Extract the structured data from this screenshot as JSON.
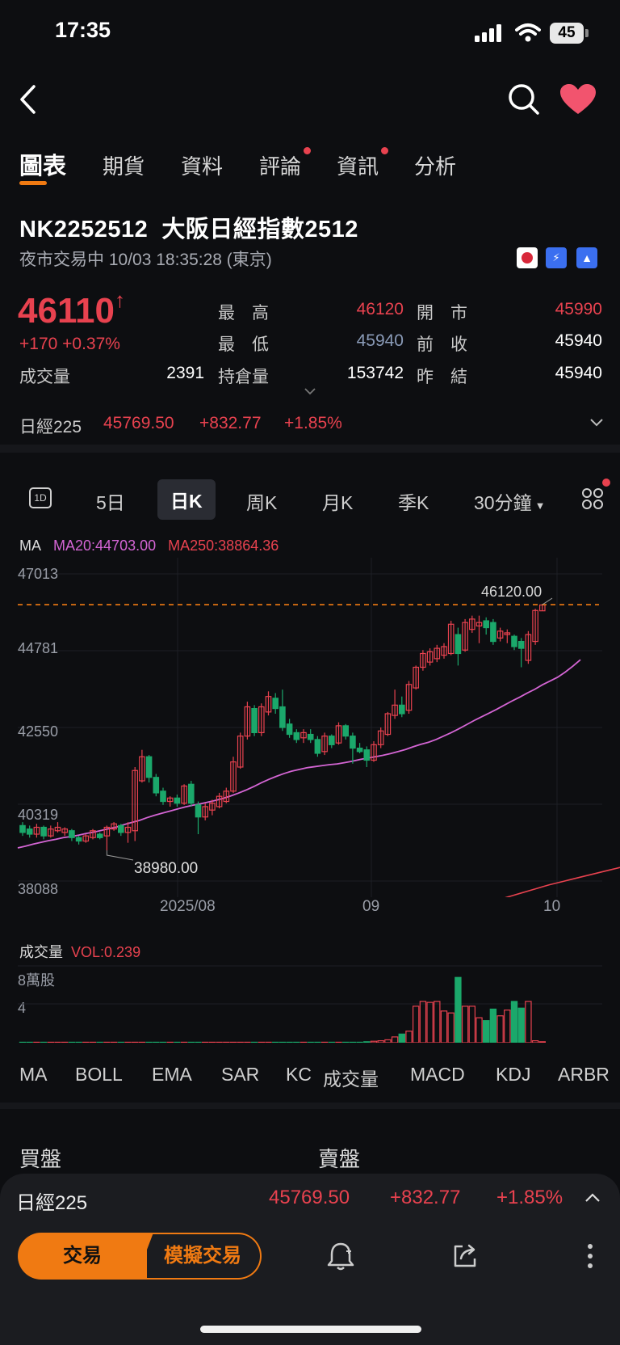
{
  "status_bar": {
    "time": "17:35",
    "battery": "45"
  },
  "tabs": [
    {
      "label": "圖表",
      "active": true,
      "dot": false
    },
    {
      "label": "期貨",
      "active": false,
      "dot": false
    },
    {
      "label": "資料",
      "active": false,
      "dot": false
    },
    {
      "label": "評論",
      "active": false,
      "dot": true
    },
    {
      "label": "資訊",
      "active": false,
      "dot": true
    },
    {
      "label": "分析",
      "active": false,
      "dot": false
    }
  ],
  "header": {
    "code": "NK2252512",
    "name": "大阪日經指數2512",
    "session": "夜市交易中 10/03 18:35:28 (東京)"
  },
  "quote": {
    "price": "46110",
    "change": "+170",
    "change_pct": "+0.37%",
    "volume_label": "成交量",
    "volume_value": "2391",
    "stats": [
      {
        "label": "最　高",
        "value": "46120",
        "color": "red"
      },
      {
        "label": "開　市",
        "value": "45990",
        "color": "red"
      },
      {
        "label": "最　低",
        "value": "45940",
        "color": "blue"
      },
      {
        "label": "前　收",
        "value": "45940",
        "color": "white"
      },
      {
        "label": "持倉量",
        "value": "153742",
        "color": "white"
      },
      {
        "label": "昨　結",
        "value": "45940",
        "color": "white"
      }
    ]
  },
  "index_bar": {
    "name": "日經225",
    "value": "45769.50",
    "change": "+832.77",
    "pct": "+1.85%"
  },
  "periods": [
    {
      "label": "5日",
      "active": false
    },
    {
      "label": "日K",
      "active": true
    },
    {
      "label": "周K",
      "active": false
    },
    {
      "label": "月K",
      "active": false
    },
    {
      "label": "季K",
      "active": false
    },
    {
      "label": "30分鐘",
      "active": false
    }
  ],
  "period_icon_label": "1D",
  "ma_legend": {
    "label": "MA",
    "ma20": "MA20:44703.00",
    "ma250": "MA250:38864.36"
  },
  "chart_data": {
    "type": "candlestick",
    "y_ticks": [
      "47013",
      "44781",
      "42550",
      "40319",
      "38088"
    ],
    "ylim": [
      38088,
      47013
    ],
    "x_ticks": [
      "2025/08",
      "09",
      "10"
    ],
    "high_marker": "46120.00",
    "low_marker": "38980.00",
    "candles": [
      {
        "o": 39700,
        "c": 39500,
        "h": 39800,
        "l": 39400
      },
      {
        "o": 39600,
        "c": 39450,
        "h": 39700,
        "l": 39350
      },
      {
        "o": 39450,
        "c": 39650,
        "h": 39750,
        "l": 39350
      },
      {
        "o": 39650,
        "c": 39400,
        "h": 39700,
        "l": 39300
      },
      {
        "o": 39400,
        "c": 39600,
        "h": 39700,
        "l": 39350
      },
      {
        "o": 39550,
        "c": 39650,
        "h": 39800,
        "l": 39500
      },
      {
        "o": 39500,
        "c": 39600,
        "h": 39650,
        "l": 39400
      },
      {
        "o": 39550,
        "c": 39350,
        "h": 39600,
        "l": 39250
      },
      {
        "o": 39350,
        "c": 39250,
        "h": 39400,
        "l": 39150
      },
      {
        "o": 39250,
        "c": 39400,
        "h": 39450,
        "l": 39200
      },
      {
        "o": 39350,
        "c": 39550,
        "h": 39600,
        "l": 39300
      },
      {
        "o": 39450,
        "c": 39350,
        "h": 39500,
        "l": 39300
      },
      {
        "o": 39400,
        "c": 39650,
        "h": 39700,
        "l": 38980
      },
      {
        "o": 39600,
        "c": 39750,
        "h": 39800,
        "l": 39550
      },
      {
        "o": 39700,
        "c": 39500,
        "h": 39750,
        "l": 39400
      },
      {
        "o": 39500,
        "c": 39650,
        "h": 39800,
        "l": 39200
      },
      {
        "o": 39550,
        "c": 41300,
        "h": 41400,
        "l": 39250
      },
      {
        "o": 41000,
        "c": 41700,
        "h": 41900,
        "l": 40950
      },
      {
        "o": 41700,
        "c": 41100,
        "h": 41750,
        "l": 40950
      },
      {
        "o": 41100,
        "c": 40650,
        "h": 41200,
        "l": 40550
      },
      {
        "o": 40700,
        "c": 40400,
        "h": 40800,
        "l": 40300
      },
      {
        "o": 40400,
        "c": 40500,
        "h": 40550,
        "l": 40250
      },
      {
        "o": 40500,
        "c": 40350,
        "h": 40600,
        "l": 40250
      },
      {
        "o": 40350,
        "c": 40850,
        "h": 40900,
        "l": 40300
      },
      {
        "o": 40900,
        "c": 40350,
        "h": 41000,
        "l": 40250
      },
      {
        "o": 40300,
        "c": 39950,
        "h": 40400,
        "l": 39450
      },
      {
        "o": 39950,
        "c": 40250,
        "h": 40350,
        "l": 39850
      },
      {
        "o": 40150,
        "c": 40350,
        "h": 40450,
        "l": 40000
      },
      {
        "o": 40250,
        "c": 40550,
        "h": 40650,
        "l": 40200
      },
      {
        "o": 40400,
        "c": 40700,
        "h": 40800,
        "l": 40350
      },
      {
        "o": 40700,
        "c": 41550,
        "h": 41700,
        "l": 40650
      },
      {
        "o": 41400,
        "c": 42300,
        "h": 42400,
        "l": 41350
      },
      {
        "o": 42300,
        "c": 43150,
        "h": 43300,
        "l": 42200
      },
      {
        "o": 43100,
        "c": 42400,
        "h": 43200,
        "l": 42300
      },
      {
        "o": 42400,
        "c": 43150,
        "h": 43250,
        "l": 42300
      },
      {
        "o": 43000,
        "c": 43450,
        "h": 43600,
        "l": 42900
      },
      {
        "o": 43400,
        "c": 43100,
        "h": 43550,
        "l": 42950
      },
      {
        "o": 43150,
        "c": 42550,
        "h": 43650,
        "l": 42450
      },
      {
        "o": 42650,
        "c": 42350,
        "h": 42800,
        "l": 42250
      },
      {
        "o": 42400,
        "c": 42200,
        "h": 42500,
        "l": 42100
      },
      {
        "o": 42250,
        "c": 42400,
        "h": 42500,
        "l": 42100
      },
      {
        "o": 42350,
        "c": 42200,
        "h": 42500,
        "l": 42100
      },
      {
        "o": 42200,
        "c": 41800,
        "h": 42300,
        "l": 41700
      },
      {
        "o": 41850,
        "c": 42300,
        "h": 42400,
        "l": 41750
      },
      {
        "o": 42300,
        "c": 42050,
        "h": 42350,
        "l": 41950
      },
      {
        "o": 42100,
        "c": 42600,
        "h": 42700,
        "l": 42050
      },
      {
        "o": 42600,
        "c": 42300,
        "h": 42650,
        "l": 42200
      },
      {
        "o": 42300,
        "c": 41950,
        "h": 42400,
        "l": 41500
      },
      {
        "o": 41950,
        "c": 41850,
        "h": 42100,
        "l": 41800
      },
      {
        "o": 41900,
        "c": 41600,
        "h": 42000,
        "l": 41400
      },
      {
        "o": 41600,
        "c": 42050,
        "h": 42150,
        "l": 41550
      },
      {
        "o": 42050,
        "c": 42450,
        "h": 42550,
        "l": 41950
      },
      {
        "o": 42350,
        "c": 42950,
        "h": 43000,
        "l": 42300
      },
      {
        "o": 42900,
        "c": 43200,
        "h": 43650,
        "l": 42800
      },
      {
        "o": 43200,
        "c": 42950,
        "h": 43450,
        "l": 42850
      },
      {
        "o": 43050,
        "c": 43800,
        "h": 43900,
        "l": 42950
      },
      {
        "o": 43700,
        "c": 44300,
        "h": 44350,
        "l": 43650
      },
      {
        "o": 44300,
        "c": 44700,
        "h": 44800,
        "l": 44200
      },
      {
        "o": 44450,
        "c": 44750,
        "h": 44850,
        "l": 44350
      },
      {
        "o": 44550,
        "c": 44850,
        "h": 44950,
        "l": 44450
      },
      {
        "o": 44650,
        "c": 44900,
        "h": 45000,
        "l": 44550
      },
      {
        "o": 44700,
        "c": 45550,
        "h": 45650,
        "l": 44650
      },
      {
        "o": 45250,
        "c": 44700,
        "h": 45450,
        "l": 44350
      },
      {
        "o": 44800,
        "c": 45600,
        "h": 45700,
        "l": 44750
      },
      {
        "o": 45400,
        "c": 45700,
        "h": 45800,
        "l": 45300
      },
      {
        "o": 45500,
        "c": 45600,
        "h": 45800,
        "l": 45000
      },
      {
        "o": 45650,
        "c": 45450,
        "h": 45750,
        "l": 45250
      },
      {
        "o": 45600,
        "c": 45050,
        "h": 45700,
        "l": 44950
      },
      {
        "o": 45150,
        "c": 45350,
        "h": 45450,
        "l": 45050
      },
      {
        "o": 45250,
        "c": 45300,
        "h": 45400,
        "l": 45000
      },
      {
        "o": 45200,
        "c": 44900,
        "h": 45250,
        "l": 44800
      },
      {
        "o": 45050,
        "c": 44850,
        "h": 45150,
        "l": 44300
      },
      {
        "o": 44500,
        "c": 45250,
        "h": 45350,
        "l": 44400
      },
      {
        "o": 45050,
        "c": 45950,
        "h": 46000,
        "l": 44950
      },
      {
        "o": 45940,
        "c": 46110,
        "h": 46120,
        "l": 45940
      }
    ],
    "ma20": [
      39050,
      39100,
      39160,
      39210,
      39260,
      39300,
      39350,
      39380,
      39420,
      39470,
      39510,
      39560,
      39610,
      39660,
      39730,
      39790,
      39850,
      39930,
      40000,
      40060,
      40120,
      40180,
      40240,
      40290,
      40330,
      40380,
      40430,
      40490,
      40560,
      40640,
      40730,
      40830,
      40940,
      41040,
      41130,
      41210,
      41280,
      41330,
      41380,
      41410,
      41440,
      41470,
      41490,
      41530,
      41570,
      41620,
      41660,
      41700,
      41740,
      41790,
      41850,
      41910,
      41990,
      42060,
      42120,
      42200,
      42300,
      42400,
      42510,
      42630,
      42750,
      42860,
      42970,
      43080,
      43200,
      43320,
      43430,
      43550,
      43660,
      43790,
      43900,
      44010,
      44160,
      44330,
      44520
    ],
    "ma250": [
      37500,
      37560,
      37620,
      37680,
      37740,
      37800,
      37860,
      37920,
      37980,
      38030,
      38080,
      38130,
      38180,
      38230,
      38280,
      38330,
      38380,
      38430,
      38480,
      38530,
      38580,
      38630,
      38680,
      38720,
      38760,
      38800,
      38840,
      38880
    ],
    "volume": {
      "label": "成交量",
      "vol_text": "VOL:0.239",
      "y_ticks": [
        "8萬股",
        "4"
      ],
      "ylim": [
        0,
        8
      ],
      "values": [
        0.05,
        0.05,
        0.05,
        0.05,
        0.05,
        0.05,
        0.05,
        0.05,
        0.05,
        0.05,
        0.05,
        0.05,
        0.05,
        0.05,
        0.05,
        0.05,
        0.05,
        0.05,
        0.05,
        0.05,
        0.05,
        0.05,
        0.05,
        0.05,
        0.05,
        0.05,
        0.05,
        0.05,
        0.05,
        0.05,
        0.05,
        0.05,
        0.05,
        0.05,
        0.05,
        0.05,
        0.05,
        0.05,
        0.05,
        0.05,
        0.05,
        0.05,
        0.05,
        0.05,
        0.05,
        0.05,
        0.05,
        0.05,
        0.05,
        0.1,
        0.15,
        0.2,
        0.3,
        0.6,
        0.9,
        1.2,
        3.8,
        4.3,
        4.2,
        4.3,
        3.3,
        3.1,
        6.8,
        3.8,
        3.8,
        2.6,
        2.3,
        3.5,
        2.8,
        3.4,
        4.3,
        3.6,
        4.3,
        0.2,
        0.1
      ]
    }
  },
  "indicators": [
    {
      "label": "MA",
      "active": true
    },
    {
      "label": "BOLL",
      "active": false
    },
    {
      "label": "EMA",
      "active": false
    },
    {
      "label": "SAR",
      "active": false
    },
    {
      "label": "KC",
      "active": false
    },
    {
      "label": "成交量",
      "active": true
    },
    {
      "label": "MACD",
      "active": false
    },
    {
      "label": "KDJ",
      "active": false
    },
    {
      "label": "ARBR",
      "active": false
    }
  ],
  "order_book": {
    "bid": "買盤",
    "ask": "賣盤"
  },
  "bottom": {
    "index_name": "日經225",
    "index_value": "45769.50",
    "index_change": "+832.77",
    "index_pct": "+1.85%",
    "trade": "交易",
    "sim_trade": "模擬交易"
  }
}
